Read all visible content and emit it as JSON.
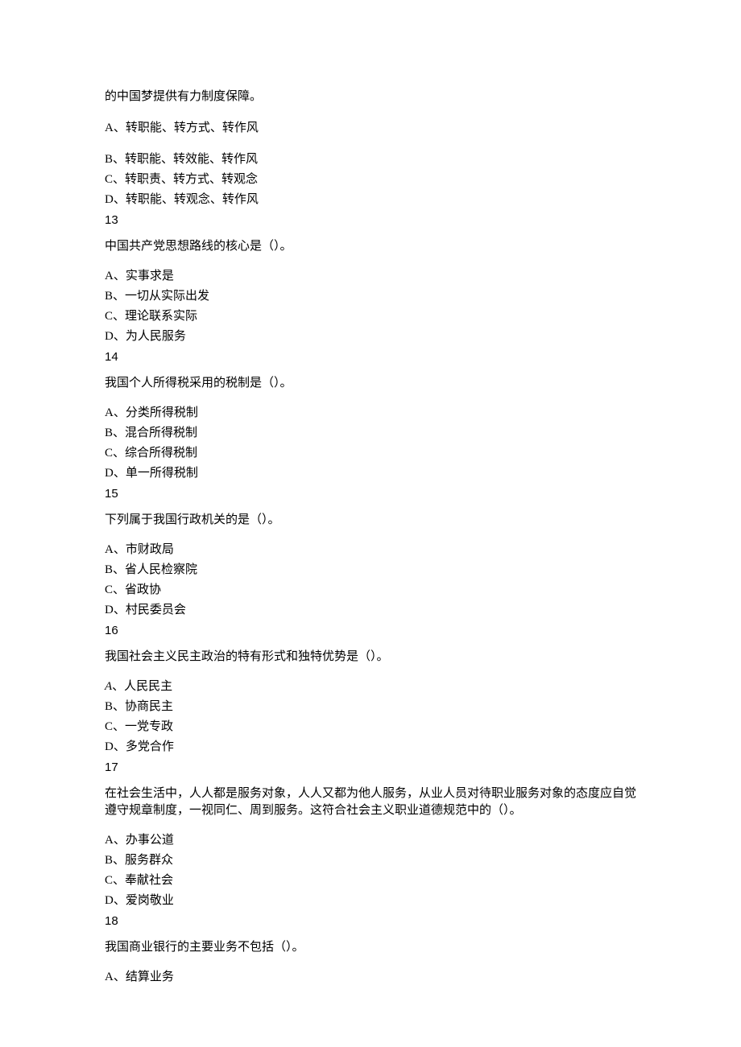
{
  "continuation": "的中国梦提供有力制度保障。",
  "q12": {
    "options": {
      "a": "A、转职能、转方式、转作风",
      "b": "B、转职能、转效能、转作风",
      "c": "C、转职责、转方式、转观念",
      "d": "D、转职能、转观念、转作风"
    }
  },
  "q13": {
    "number": "13",
    "stem": "中国共产党思想路线的核心是（）。",
    "options": {
      "a": "A、实事求是",
      "b": "B、一切从实际出发",
      "c": "C、理论联系实际",
      "d": "D、为人民服务"
    }
  },
  "q14": {
    "number": "14",
    "stem": "我国个人所得税采用的税制是（）。",
    "options": {
      "a": "A、分类所得税制",
      "b": "B、混合所得税制",
      "c": "C、综合所得税制",
      "d": "D、单一所得税制"
    }
  },
  "q15": {
    "number": "15",
    "stem": "下列属于我国行政机关的是（）。",
    "options": {
      "a": "A、市财政局",
      "b": "B、省人民检察院",
      "c": "C、省政协",
      "d": "D、村民委员会"
    }
  },
  "q16": {
    "number": "16",
    "stem": "我国社会主义民主政治的特有形式和独特优势是（）。",
    "options": {
      "a_label": "A",
      "a_text": "、人民民主",
      "b": "B、协商民主",
      "c": "C、一党专政",
      "d": "D、多党合作"
    }
  },
  "q17": {
    "number": "17",
    "stem": "在社会生活中，人人都是服务对象，人人又都为他人服务，从业人员对待职业服务对象的态度应自觉遵守规章制度，一视同仁、周到服务。这符合社会主义职业道德规范中的（）。",
    "options": {
      "a": "A、办事公道",
      "b": "B、服务群众",
      "c": "C、奉献社会",
      "d": "D、爱岗敬业"
    }
  },
  "q18": {
    "number": "18",
    "stem": "我国商业银行的主要业务不包括（）。",
    "options": {
      "a": "A、结算业务"
    }
  }
}
